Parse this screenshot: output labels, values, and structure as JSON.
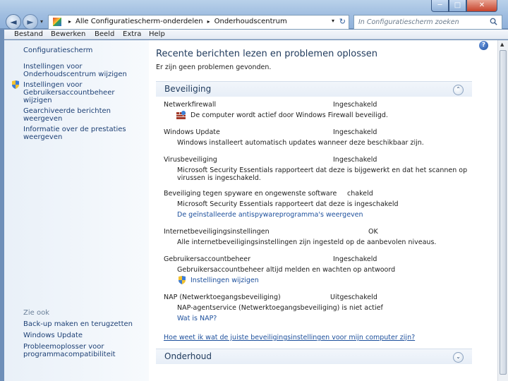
{
  "window": {
    "minimize_glyph": "─",
    "maximize_glyph": "□",
    "close_glyph": "✕"
  },
  "nav": {
    "back_glyph": "◄",
    "forward_glyph": "►",
    "dropdown_glyph": "▾"
  },
  "address": {
    "crumbs": [
      "Alle Configuratiescherm-onderdelen",
      "Onderhoudscentrum"
    ],
    "separator": "▸",
    "dropdown_glyph": "▾",
    "refresh_glyph": "↻",
    "icon": "control-panel-icon"
  },
  "search": {
    "placeholder": "In Configuratiescherm zoeken",
    "icon": "search-icon"
  },
  "menu": [
    "Bestand",
    "Bewerken",
    "Beeld",
    "Extra",
    "Help"
  ],
  "sidebar": {
    "home": "Configuratiescherm",
    "links": [
      "Instellingen voor Onderhoudscentrum wijzigen",
      "Instellingen voor Gebruikersaccountbeheer wijzigen",
      "Gearchiveerde berichten weergeven",
      "Informatie over de prestaties weergeven"
    ],
    "see_also_heading": "Zie ook",
    "see_also": [
      "Back-up maken en terugzetten",
      "Windows Update",
      "Probleemoplosser voor programmacompatibiliteit"
    ]
  },
  "main": {
    "title": "Recente berichten lezen en problemen oplossen",
    "subtitle": "Er zijn geen problemen gevonden.",
    "help_glyph": "?",
    "security": {
      "heading": "Beveiliging",
      "collapse_glyph": "⌃",
      "items": [
        {
          "name": "Netwerkfirewall",
          "status": "Ingeschakeld",
          "desc": "De computer wordt actief door Windows Firewall beveiligd."
        },
        {
          "name": "Windows Update",
          "status": "Ingeschakeld",
          "desc": "Windows installeert automatisch updates wanneer deze beschikbaar zijn."
        },
        {
          "name": "Virusbeveiliging",
          "status": "Ingeschakeld",
          "desc": "Microsoft Security Essentials rapporteert dat deze is bijgewerkt en dat het scannen op virussen is ingeschakeld."
        },
        {
          "name": "Beveiliging tegen spyware en ongewenste software",
          "status": "chakeld",
          "desc": "Microsoft Security Essentials rapporteert dat deze is ingeschakeld",
          "link": "De geïnstalleerde antispywareprogramma's weergeven"
        },
        {
          "name": "Internetbeveiligingsinstellingen",
          "status": "OK",
          "desc": "Alle internetbeveiligingsinstellingen zijn ingesteld op de aanbevolen niveaus."
        },
        {
          "name": "Gebruikersaccountbeheer",
          "status": "Ingeschakeld",
          "desc": "Gebruikersaccountbeheer altijd melden en wachten op antwoord",
          "link": "Instellingen wijzigen"
        },
        {
          "name": "NAP (Netwerktoegangsbeveiliging)",
          "status": "Uitgeschakeld",
          "desc": "NAP-agentservice (Netwerktoegangsbeveiliging) is niet actief",
          "link": "Wat is NAP?"
        }
      ],
      "footer_link": "Hoe weet ik wat de juiste beveiligingsinstellingen voor mijn computer zijn?"
    },
    "maintenance": {
      "heading": "Onderhoud",
      "expand_glyph": "⌄"
    }
  },
  "scroll": {
    "up_glyph": "▲",
    "down_glyph": "▼"
  }
}
